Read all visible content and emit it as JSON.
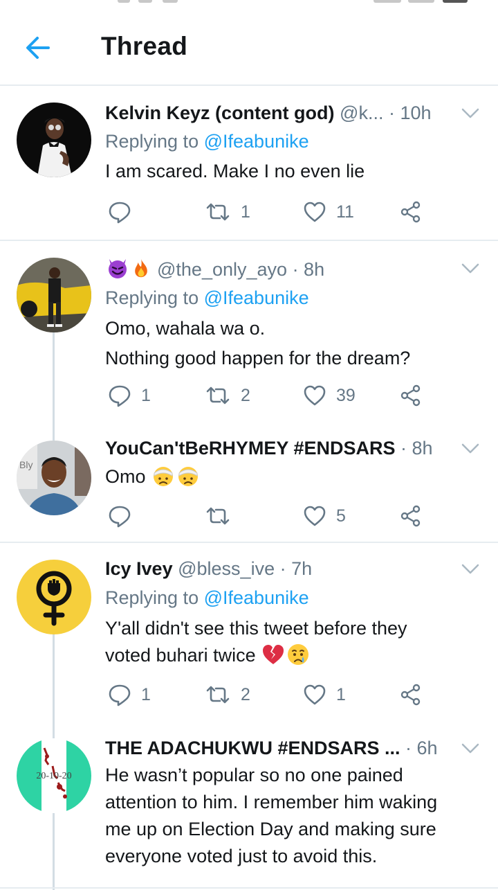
{
  "header": {
    "title": "Thread"
  },
  "tweets": [
    {
      "name": "Kelvin Keyz (content god)",
      "handle": "@k...",
      "time": "· 10h",
      "reply_prefix": "Replying to",
      "reply_to": "@Ifeabunike",
      "lines": [
        "I am scared. Make I no even lie"
      ],
      "reply_count": "",
      "retweet_count": "1",
      "like_count": "11"
    },
    {
      "name": "",
      "handle": "@the_only_ayo",
      "time": "· 8h",
      "name_emojis": [
        "smiling-imp-emoji",
        "fire-emoji"
      ],
      "reply_prefix": "Replying to",
      "reply_to": "@Ifeabunike",
      "lines": [
        "Omo, wahala wa o.",
        "Nothing good happen for the dream?"
      ],
      "reply_count": "1",
      "retweet_count": "2",
      "like_count": "39"
    },
    {
      "name": "YouCan'tBeRHYMEY #ENDSARS",
      "handle": "",
      "time": "· 8h",
      "lines": [
        "Omo"
      ],
      "text_emojis": [
        "bandaged-head-emoji",
        "bandaged-head-emoji"
      ],
      "reply_count": "",
      "retweet_count": "",
      "like_count": "5"
    },
    {
      "name": "Icy Ivey",
      "handle": "@bless_ive",
      "time": "· 7h",
      "reply_prefix": "Replying to",
      "reply_to": "@Ifeabunike",
      "lines": [
        "Y'all didn't see this tweet before they",
        "voted buhari twice"
      ],
      "text_emojis": [
        "broken-heart-emoji",
        "crying-face-emoji"
      ],
      "reply_count": "1",
      "retweet_count": "2",
      "like_count": "1"
    },
    {
      "name": "THE ADACHUKWU #ENDSARS ...",
      "handle": "",
      "time": "· 6h",
      "lines": [
        "He wasn’t popular so no one pained",
        "attention to him. I remember him waking",
        "me up on Election Day and making sure",
        "everyone voted just to avoid this."
      ],
      "avatar_text": "20-10-20"
    }
  ],
  "colors": {
    "accent": "#1da1f2",
    "secondary_text": "#657786",
    "primary_text": "#14171a",
    "divider": "#e6ecf0"
  },
  "icons": [
    "back-arrow-icon",
    "chevron-down-icon",
    "reply-icon",
    "retweet-icon",
    "like-icon",
    "share-icon"
  ]
}
